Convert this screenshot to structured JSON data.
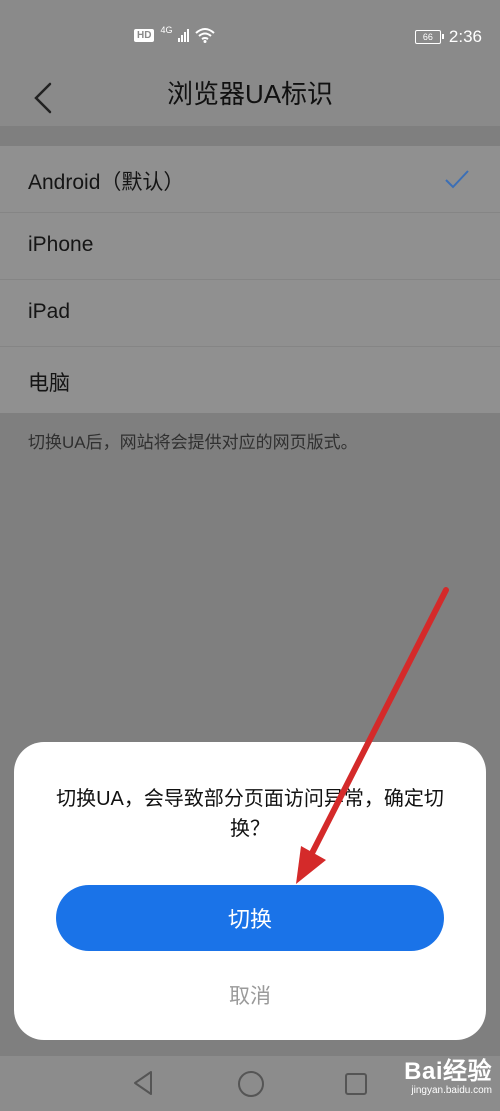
{
  "status_bar": {
    "hd_badge": "HD",
    "network_gen": "4G",
    "battery_level": "66",
    "time": "2:36"
  },
  "header": {
    "back_icon": "chevron-left-icon",
    "title": "浏览器UA标识"
  },
  "ua_options": [
    {
      "label": "Android（默认）",
      "selected": true
    },
    {
      "label": "iPhone",
      "selected": false
    },
    {
      "label": "iPad",
      "selected": false
    },
    {
      "label": "电脑",
      "selected": false
    }
  ],
  "hint": "切换UA后，网站将会提供对应的网页版式。",
  "dialog": {
    "message": "切换UA，会导致部分页面访问异常，确定切换？",
    "confirm_label": "切换",
    "cancel_label": "取消",
    "confirm_color": "#1a73e8"
  },
  "watermark": {
    "brand": "Bai经验",
    "url": "jingyan.baidu.com"
  },
  "annotation": {
    "arrow_color": "#d42a2a"
  }
}
